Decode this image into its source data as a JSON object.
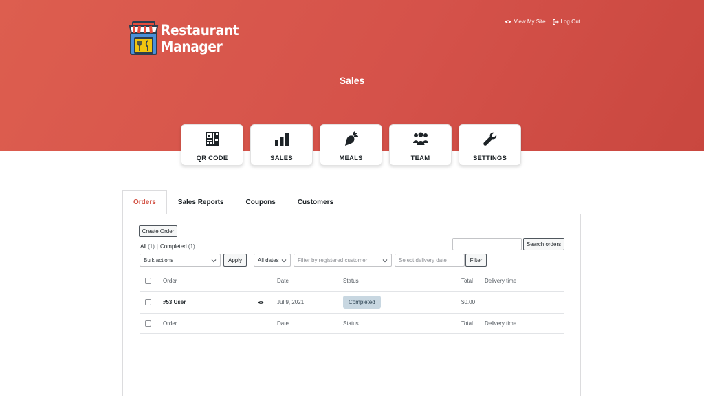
{
  "header": {
    "logo_line1": "Restaurant",
    "logo_line2": "Manager",
    "links": [
      {
        "label": "View My Site",
        "icon": "eye-icon"
      },
      {
        "label": "Log Out",
        "icon": "logout-icon"
      }
    ],
    "page_title": "Sales"
  },
  "nav": [
    {
      "label": "QR CODE",
      "icon": "qr-code-icon"
    },
    {
      "label": "SALES",
      "icon": "bar-chart-icon"
    },
    {
      "label": "MEALS",
      "icon": "carrot-icon"
    },
    {
      "label": "TEAM",
      "icon": "team-icon"
    },
    {
      "label": "SETTINGS",
      "icon": "wrench-icon"
    }
  ],
  "tabs": [
    {
      "label": "Orders",
      "active": true
    },
    {
      "label": "Sales Reports",
      "active": false
    },
    {
      "label": "Coupons",
      "active": false
    },
    {
      "label": "Customers",
      "active": false
    }
  ],
  "orders": {
    "create_button": "Create Order",
    "views": {
      "all_label": "All",
      "all_count": "(1)",
      "separator": "|",
      "completed_label": "Completed",
      "completed_count": "(1)"
    },
    "search_value": "",
    "search_button": "Search orders",
    "bulk_actions": "Bulk actions",
    "apply_button": "Apply",
    "dates_filter": "All dates",
    "customer_filter_placeholder": "Filter by registered customer",
    "delivery_date_placeholder": "Select delivery date",
    "filter_button": "Filter",
    "columns": {
      "order": "Order",
      "date": "Date",
      "status": "Status",
      "total": "Total",
      "delivery": "Delivery time"
    },
    "rows": [
      {
        "order": "#53 User",
        "date": "Jul 9, 2021",
        "status": "Completed",
        "total": "$0.00",
        "delivery": ""
      }
    ]
  },
  "colors": {
    "accent": "#d35446",
    "hero": "#d5524a",
    "badge_bg": "#c8d7e1"
  }
}
